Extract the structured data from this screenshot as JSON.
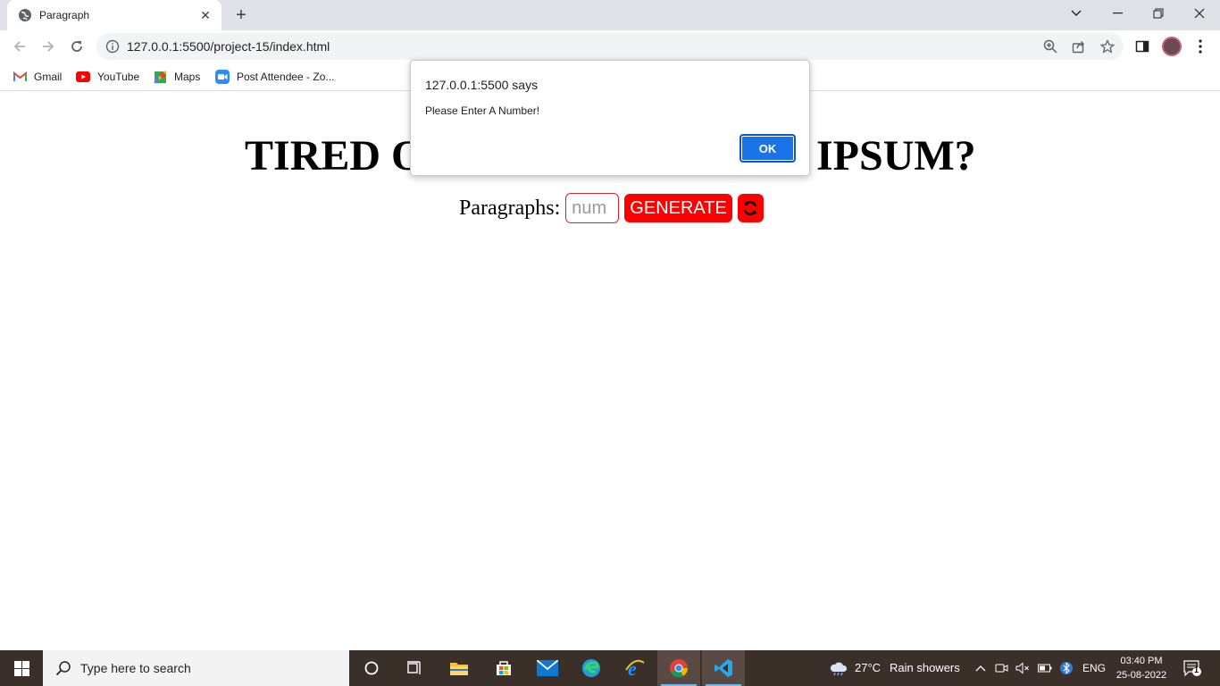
{
  "browser": {
    "tab_title": "Paragraph",
    "url": "127.0.0.1:5500/project-15/index.html",
    "bookmarks": [
      {
        "label": "Gmail",
        "icon": "gmail-icon"
      },
      {
        "label": "YouTube",
        "icon": "youtube-icon"
      },
      {
        "label": "Maps",
        "icon": "maps-icon"
      },
      {
        "label": "Post Attendee - Zo...",
        "icon": "zoom-icon"
      }
    ]
  },
  "page": {
    "headline_left": "TIRED O",
    "headline_right": "IPSUM?",
    "paragraphs_label": "Paragraphs:",
    "num_placeholder": "num",
    "generate_label": "GENERATE"
  },
  "dialog": {
    "origin": "127.0.0.1:5500 says",
    "message": "Please Enter A Number!",
    "ok_label": "OK"
  },
  "taskbar": {
    "search_placeholder": "Type here to search",
    "weather_temp": "27°C",
    "weather_desc": "Rain showers",
    "language": "ENG",
    "time": "03:40 PM",
    "date": "25-08-2022",
    "notification_count": "1"
  },
  "colors": {
    "accent_red": "#ff0000",
    "dialog_button": "#1a73e8",
    "taskbar": "#3b2f2a"
  }
}
